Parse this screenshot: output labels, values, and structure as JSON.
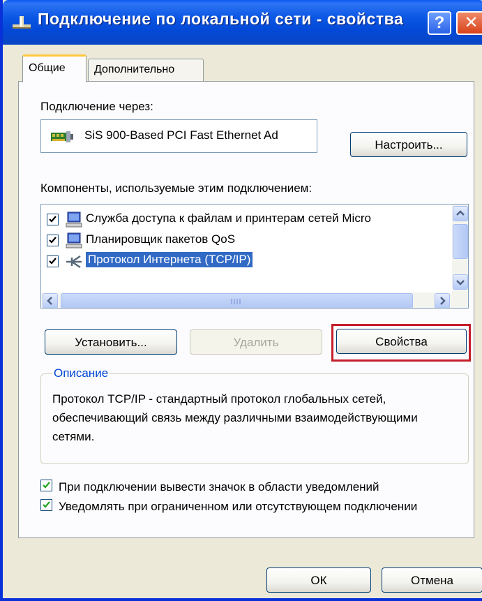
{
  "window": {
    "title": "Подключение по локальной сети - свойства",
    "help_glyph": "?",
    "close_glyph": "✕"
  },
  "tabs": [
    {
      "label": "Общие",
      "active": true
    },
    {
      "label": "Дополнительно",
      "active": false
    }
  ],
  "connection": {
    "via_label": "Подключение через:",
    "adapter_name": "SiS 900-Based PCI Fast Ethernet Ad",
    "adapter_icon": "network-card-icon",
    "configure_label": "Настроить..."
  },
  "components": {
    "label": "Компоненты, используемые этим подключением:",
    "items": [
      {
        "label": "Служба доступа к файлам и принтерам сетей Micro",
        "checked": true,
        "icon": "service-computer-icon"
      },
      {
        "label": "Планировщик пакетов QoS",
        "checked": true,
        "icon": "service-computer-icon"
      },
      {
        "label": "Протокол Интернета (TCP/IP)",
        "checked": true,
        "icon": "protocol-icon",
        "selected": true
      }
    ]
  },
  "buttons": {
    "install": "Установить...",
    "remove": "Удалить",
    "properties": "Свойства",
    "ok": "ОК",
    "cancel": "Отмена"
  },
  "description": {
    "legend": "Описание",
    "text": "Протокол TCP/IP - стандартный протокол глобальных сетей, обеспечивающий связь между различными взаимодействующими сетями."
  },
  "options": [
    {
      "label": "При подключении вывести значок в области уведомлений",
      "checked": true
    },
    {
      "label": "Уведомлять при ограниченном или отсутствующем подключении",
      "checked": true
    }
  ],
  "colors": {
    "titlebar": "#0a56e4",
    "selection": "#316ac5",
    "highlight_frame": "#c41e2a",
    "legend_text": "#0046d5"
  }
}
